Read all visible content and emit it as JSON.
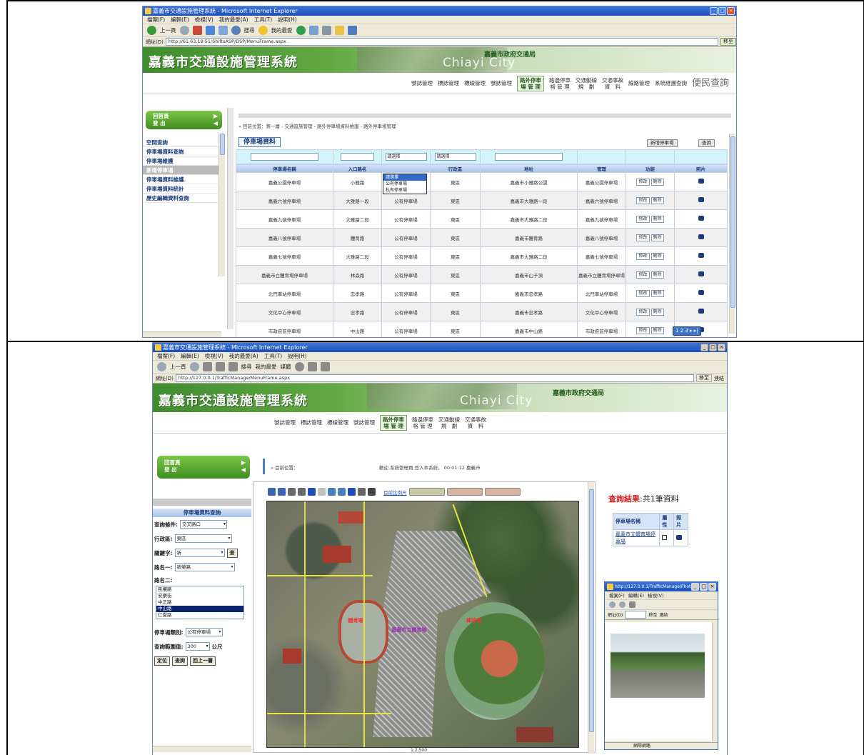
{
  "screenshot1": {
    "window_title": "嘉義市交通設施管理系統 - Microsoft Internet Explorer",
    "menu": [
      "檔案(F)",
      "編輯(E)",
      "檢視(V)",
      "我的最愛(A)",
      "工具(T)",
      "說明(H)"
    ],
    "toolbar": {
      "back": "上一頁",
      "search": "搜尋",
      "favorites": "我的最愛"
    },
    "address_label": "網址(D)",
    "address": "http://61.63.18.51/ShiftsASP/DSP/MenuFrame.aspx",
    "go_label": "移至",
    "site_title": "嘉義市交通設施管理系統",
    "city_label": "Chiayi City",
    "gov_label": "嘉義市政府交通局",
    "nav": [
      "號誌管理",
      "標誌管理",
      "標線管理",
      "號誌管理",
      "路外停車\n場 管 理",
      "路邊停車\n格 管 理",
      "交通動線\n規　劃",
      "交通事故\n資　料",
      "線路管理",
      "系統維護查詢",
      "便民查詢"
    ],
    "home": {
      "back": "回首頁",
      "logout": "登 出"
    },
    "sidebar": [
      "空間查詢",
      "停車場資料查詢",
      "停車場維護",
      "新增停車場",
      "停車場資料維護",
      "停車場資料統計",
      "歷史編輯資料查詢"
    ],
    "breadcrumb": "» 目前位置：第一層 - 交通設施管理 - 路外停車場資料維護 - 路外停車場管理",
    "grid_title": "停車場資料",
    "buttons": {
      "add": "新增停車場",
      "search": "查詢"
    },
    "filter_select_1": "請選擇",
    "filter_select_2": "請選擇",
    "dropdown_options": [
      "請選擇",
      "公有停車場",
      "私有停車場"
    ],
    "columns": [
      "停車場名稱",
      "入口路名",
      "",
      "行政區",
      "地址",
      "管理",
      "功能",
      "照片"
    ],
    "rows": [
      {
        "name": "嘉義公園停車場",
        "entry": "小雅路",
        "type": "",
        "district": "東區",
        "address": "嘉義市小雅路公園",
        "manager": "嘉義公園停車場"
      },
      {
        "name": "嘉義六號停車場",
        "entry": "大雅路一段",
        "type": "公有停車場",
        "district": "東區",
        "address": "嘉義市大雅路一段",
        "manager": "嘉義六號停車場"
      },
      {
        "name": "嘉義九號停車場",
        "entry": "大雅路二段",
        "type": "公有停車場",
        "district": "東區",
        "address": "嘉義市大雅路二段",
        "manager": "嘉義九號停車場"
      },
      {
        "name": "嘉義八號停車場",
        "entry": "體育路",
        "type": "公有停車場",
        "district": "東區",
        "address": "嘉義市體育路",
        "manager": "嘉義八號停車場"
      },
      {
        "name": "嘉義七號停車場",
        "entry": "大雅路二段",
        "type": "公有停車場",
        "district": "東區",
        "address": "嘉義市大雅路二段",
        "manager": "嘉義七號停車場"
      },
      {
        "name": "嘉義市立體育場停車場",
        "entry": "林森路",
        "type": "公有停車場",
        "district": "東區",
        "address": "嘉義市山子頂",
        "manager": "嘉義市立體育場停車場"
      },
      {
        "name": "北門車站停車場",
        "entry": "忠孝路",
        "type": "公有停車場",
        "district": "東區",
        "address": "嘉義市忠孝路",
        "manager": "北門車站停車場"
      },
      {
        "name": "文化中心停車場",
        "entry": "忠孝路",
        "type": "公有停車場",
        "district": "東區",
        "address": "嘉義市忠孝路",
        "manager": "文化中心停車場"
      },
      {
        "name": "市政府前停車場",
        "entry": "中山路",
        "type": "公有停車場",
        "district": "東區",
        "address": "嘉義市中山路",
        "manager": "市政府前停車場"
      }
    ],
    "row_actions": {
      "edit": "修改",
      "delete": "刪除"
    },
    "pager": "1 2 3 ▸ ▸|"
  },
  "screenshot2": {
    "window_title": "嘉義市交通設施管理系統 - Microsoft Internet Explorer",
    "menu": [
      "檔案(F)",
      "編輯(E)",
      "檢視(V)",
      "我的最愛(A)",
      "工具(T)",
      "說明(H)"
    ],
    "toolbar": {
      "back": "上一頁",
      "search": "搜尋",
      "favorites": "我的最愛",
      "media": "媒體"
    },
    "address_label": "網址(D)",
    "address": "http://127.0.0.1/TrafficManage/MenuFrame.aspx",
    "go_label": "移至",
    "links_label": "連結",
    "site_title": "嘉義市交通設施管理系統",
    "city_label": "Chiayi City",
    "gov_label": "嘉義市政府交通局",
    "nav": [
      "號誌管理",
      "標誌管理",
      "標線管理",
      "號誌管理",
      "路外停車\n場 管 理",
      "路邊停車\n格 管 理",
      "交通動線\n規　劃",
      "交通事故\n資　料"
    ],
    "home": {
      "back": "回首頁",
      "logout": "登 出"
    },
    "breadcrumb": "» 目前位置：",
    "welcome": "歡迎 系統管理員 登入本系統， 00:01:12 嘉義市",
    "query_panel_title": "停車場資料查詢",
    "query_condition_label": "查詢條件:",
    "query_condition_value": "交叉路口",
    "district_label": "行政區:",
    "district_value": "東區",
    "keyword_label": "關鍵字:",
    "keyword_value": "新",
    "keyword_btn": "查",
    "road1_label": "路名一:",
    "road1_value": "新榮路",
    "road2_label": "路名二:",
    "road2_options": [
      "民權路",
      "安樂街",
      "中正路",
      "中山路",
      "仁愛路"
    ],
    "road2_selected_index": 3,
    "lot_type_label": "停車場類別:",
    "lot_type_value": "公有停車場",
    "radius_label": "查詢範圍值:",
    "radius_value": "300",
    "radius_unit": "公尺",
    "btn_locate": "定位",
    "btn_query": "查詢",
    "btn_prev": "回上一層",
    "map_scale_label": "目前比例尺",
    "map_labels": [
      "體育場",
      "嘉義市立體育場",
      "棒球場"
    ],
    "result_title": "查詢結果",
    "result_count": ":共1筆資料",
    "result_columns": [
      "停車場名稱",
      "屬性",
      "照片"
    ],
    "result_rows": [
      {
        "name": "嘉義市立體育場停車場"
      }
    ],
    "popup_title": "http://127.0.0.1/TrafficManage/Photo.aspx",
    "popup_menu": [
      "檔案(F)",
      "編輯(E)",
      "檢視(V)"
    ],
    "popup_address_label": "網址(D)",
    "popup_go": "移至",
    "popup_links": "連結",
    "map_bottom_scale": "1:2,500",
    "status_local": "網際網路"
  }
}
